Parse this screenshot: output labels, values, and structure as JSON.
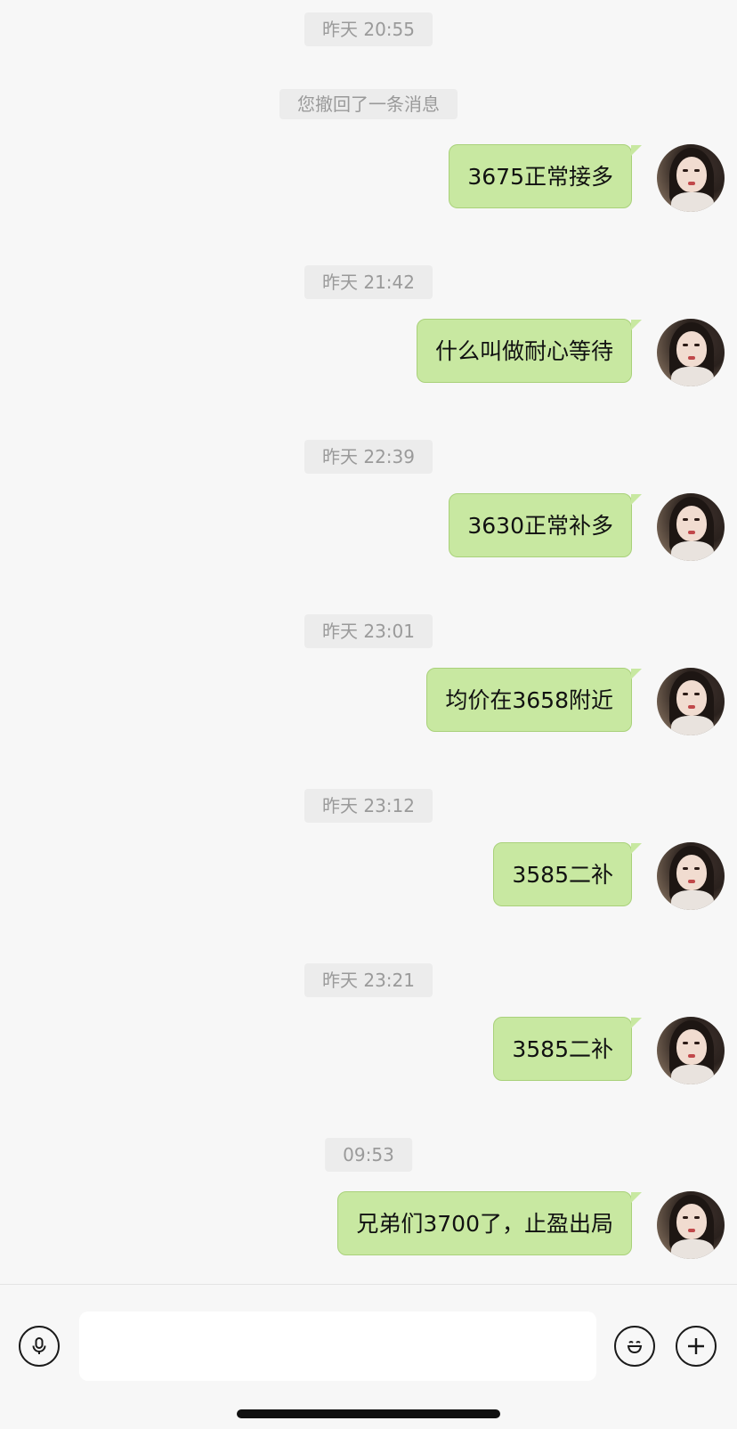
{
  "colors": {
    "background": "#f7f7f7",
    "bubble_self": "#c8e8a1",
    "bubble_border": "#a9d17a",
    "timestamp_bg": "#ececec",
    "timestamp_text": "#9a9a9a"
  },
  "chat": {
    "timestamps": [
      "昨天 20:55",
      "昨天 21:42",
      "昨天 22:39",
      "昨天 23:01",
      "昨天 23:12",
      "昨天 23:21",
      "09:53"
    ],
    "system_note": "您撤回了一条消息",
    "messages": [
      {
        "text": "3675正常接多",
        "sender": "self"
      },
      {
        "text": "什么叫做耐心等待",
        "sender": "self"
      },
      {
        "text": "3630正常补多",
        "sender": "self"
      },
      {
        "text": "均价在3658附近",
        "sender": "self"
      },
      {
        "text": "3585二补",
        "sender": "self"
      },
      {
        "text": "3585二补",
        "sender": "self"
      },
      {
        "text": "兄弟们3700了，止盈出局",
        "sender": "self"
      }
    ]
  },
  "input_bar": {
    "voice_icon": "microphone-icon",
    "emoji_icon": "emoji-icon",
    "plus_icon": "plus-icon",
    "placeholder": ""
  }
}
